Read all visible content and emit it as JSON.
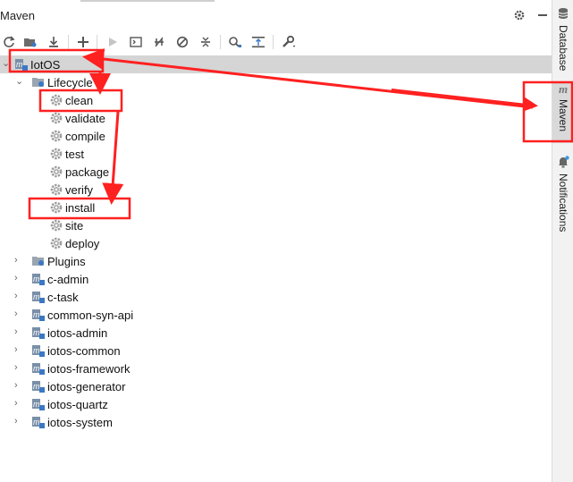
{
  "panel": {
    "title": "Maven"
  },
  "header_icons": [
    "gear-icon",
    "minimize-icon"
  ],
  "toolbar": {
    "buttons": [
      {
        "name": "reload-icon",
        "glyph": "⟳"
      },
      {
        "name": "generate-sources-icon",
        "glyph": "▣"
      },
      {
        "name": "download-icon",
        "glyph": "⤓"
      },
      {
        "name": "add-icon",
        "glyph": "+"
      },
      {
        "name": "run-icon",
        "glyph": "▶"
      },
      {
        "name": "execute-goal-icon",
        "glyph": "▤"
      },
      {
        "name": "toggle-offline-icon",
        "glyph": "⧸"
      },
      {
        "name": "skip-tests-icon",
        "glyph": "⊘"
      },
      {
        "name": "collapse-icon",
        "glyph": "⇕"
      },
      {
        "name": "show-dependencies-icon",
        "glyph": "⌕"
      },
      {
        "name": "collapse-all-icon",
        "glyph": "⇈"
      },
      {
        "name": "settings-wrench-icon",
        "glyph": "🔧"
      }
    ]
  },
  "tree": {
    "root": "IotOS",
    "lifecycle_label": "Lifecycle",
    "lifecycle_goals": [
      "clean",
      "validate",
      "compile",
      "test",
      "package",
      "verify",
      "install",
      "site",
      "deploy"
    ],
    "plugins_label": "Plugins",
    "modules": [
      "c-admin",
      "c-task",
      "common-syn-api",
      "iotos-admin",
      "iotos-common",
      "iotos-framework",
      "iotos-generator",
      "iotos-quartz",
      "iotos-system"
    ]
  },
  "right_tabs": {
    "database": "Database",
    "maven": "Maven",
    "notifications": "Notifications"
  },
  "colors": {
    "annotation": "#ff2020",
    "selected_row": "#d5d5d5",
    "gear": "#9a9a9a",
    "module_icon": "#3b78c4"
  }
}
